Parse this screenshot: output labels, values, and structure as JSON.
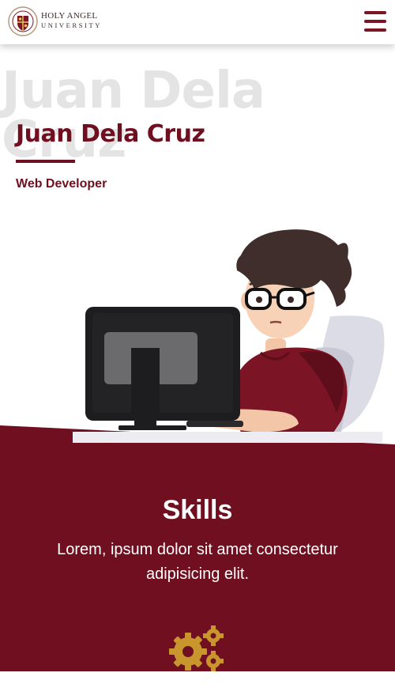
{
  "header": {
    "logo_icon": "university-seal-icon",
    "logo_line1": "HOLY ANGEL",
    "logo_line2": "UNIVERSITY",
    "menu_icon": "hamburger-menu-icon"
  },
  "hero": {
    "background_name": "Juan Dela Cruz",
    "name": "Juan Dela Cruz",
    "role": "Web Developer",
    "illustration": "developer-at-computer-illustration"
  },
  "skills": {
    "title": "Skills",
    "description": "Lorem, ipsum dolor sit amet consectetur adipisicing elit.",
    "icon": "gears-icon"
  },
  "colors": {
    "brand_maroon": "#6f0f1f",
    "gear_gold": "#c9962e",
    "watermark_gray": "#e4e4e4"
  }
}
